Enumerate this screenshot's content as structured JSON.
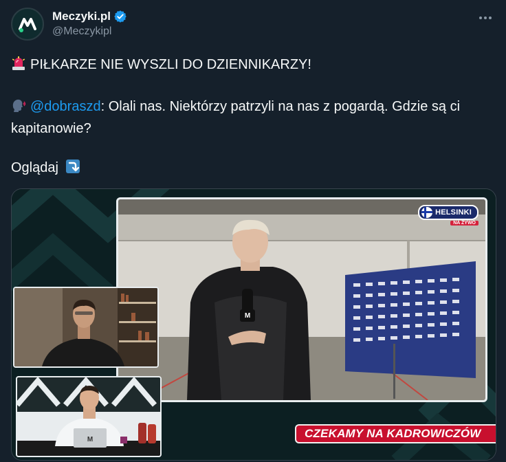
{
  "author": {
    "display_name": "Meczyki.pl",
    "handle": "@Meczykipl",
    "verified": true,
    "avatar_icon": "meczyki-logo-icon",
    "accent_color": "#2ad18a"
  },
  "tweet": {
    "headline": "PIŁKARZE NIE WYSZLI DO DZIENNIKARZY!",
    "headline_emoji": "police-light-icon",
    "quote_mention": "@dobraszd",
    "quote_text": ": Olali nas. Niektórzy patrzyli na nas z pogardą. Gdzie są ci kapitanowie?",
    "quote_emoji": "speaking-head-icon",
    "watch_label": "Oglądaj",
    "watch_emoji": "arrow-curve-down-icon"
  },
  "media": {
    "badge_city": "HELSINKI",
    "badge_live": "NA ŻYWO",
    "ticker": "CZEKAMY NA KADROWICZÓW",
    "mic_logo": "M"
  },
  "colors": {
    "background": "#15202b",
    "text": "#f7f9f9",
    "secondary": "#8b98a5",
    "link": "#1d9bf0",
    "ticker_red": "#c8102e"
  }
}
